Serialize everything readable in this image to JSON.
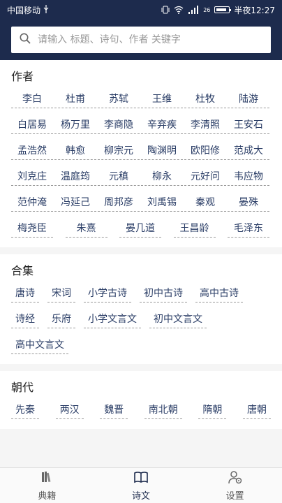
{
  "status": {
    "carrier": "中国移动",
    "signal_label": "26",
    "time": "半夜12:27"
  },
  "search": {
    "placeholder": "请输入 标题、诗句、作者 关键字"
  },
  "sections": {
    "authors": {
      "title": "作者",
      "items": [
        "李白",
        "杜甫",
        "苏轼",
        "王维",
        "杜牧",
        "陆游",
        "白居易",
        "杨万里",
        "李商隐",
        "辛弃疾",
        "李清照",
        "王安石",
        "孟浩然",
        "韩愈",
        "柳宗元",
        "陶渊明",
        "欧阳修",
        "范成大",
        "刘克庄",
        "温庭筠",
        "元稹",
        "柳永",
        "元好问",
        "韦应物",
        "范仲淹",
        "冯延己",
        "周邦彦",
        "刘禹锡",
        "秦观",
        "晏殊",
        "梅尧臣",
        "朱熹",
        "晏几道",
        "王昌龄",
        "毛泽东"
      ]
    },
    "collections": {
      "title": "合集",
      "items": [
        "唐诗",
        "宋词",
        "小学古诗",
        "初中古诗",
        "高中古诗",
        "诗经",
        "乐府",
        "小学文言文",
        "初中文言文",
        "高中文言文"
      ]
    },
    "dynasties": {
      "title": "朝代",
      "items": [
        "先秦",
        "两汉",
        "魏晋",
        "南北朝",
        "隋朝",
        "唐朝"
      ]
    }
  },
  "tabs": [
    {
      "label": "典籍",
      "icon": "books-icon"
    },
    {
      "label": "诗文",
      "icon": "open-book-icon"
    },
    {
      "label": "设置",
      "icon": "user-settings-icon"
    }
  ],
  "colors": {
    "header_bg": "#1d2b4d",
    "tag_text": "#2a3d66"
  }
}
